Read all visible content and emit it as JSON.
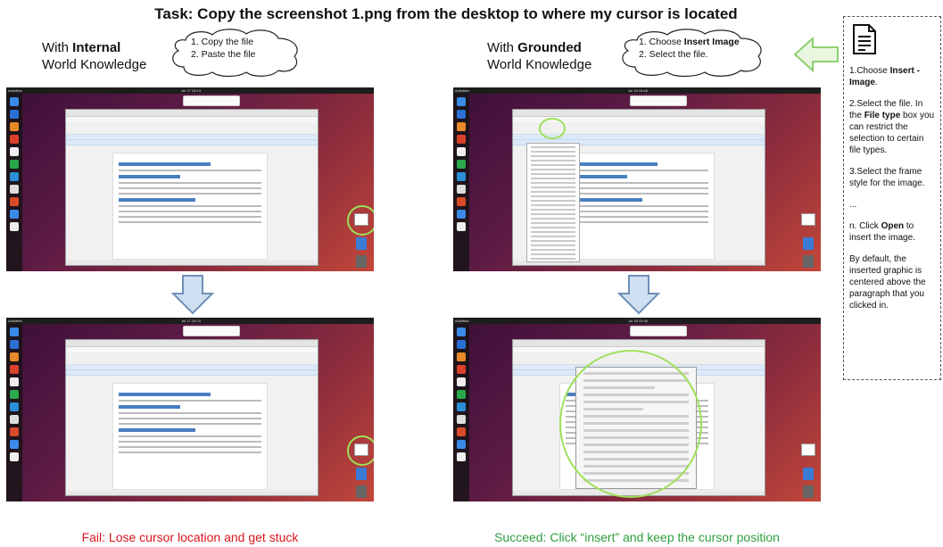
{
  "title": "Task: Copy the screenshot 1.png from the desktop to where my cursor is located",
  "left": {
    "header_prefix": "With ",
    "header_bold": "Internal",
    "header_line2": "World Knowledge",
    "steps": [
      "1. Copy the file",
      "2. Paste the file"
    ],
    "caption": "Fail: Lose cursor location and  get stuck",
    "caption_color": "#d9141b"
  },
  "right": {
    "header_prefix": "With ",
    "header_bold": "Grounded",
    "header_line2": "World Knowledge",
    "step1_prefix": "1. Choose ",
    "step1_bold": "Insert Image",
    "step2": "2. Select the file.",
    "caption": "Succeed: Click “insert” and keep the cursor position",
    "caption_color": "#2e9e3e"
  },
  "knowledge": {
    "icon": "document-icon",
    "s1_prefix": "1.Choose ",
    "s1_bold": "Insert - Image",
    "s1_suffix": ".",
    "s2_prefix": "2.Select the file. In the ",
    "s2_bold": "File type",
    "s2_suffix": " box you can restrict the selection to certain file types.",
    "s3": "3.Select the frame style for the image.",
    "ellipsis": "...",
    "sn_prefix": "n. Click ",
    "sn_bold": "Open",
    "sn_suffix": " to insert the image.",
    "note": "By default, the inserted graphic is centered above the paragraph that you clicked in."
  },
  "screens": {
    "doc_title": "Viewing Your Class Schedule and Textbooks",
    "window_title": "Viewing_Your_Class_Schedule_and_Textbooks.docx - LibreOffice Writer",
    "notification": "Software Updater"
  },
  "colors": {
    "arrow_blue_fill": "#cfe0f3",
    "arrow_blue_stroke": "#6f8fb7",
    "arrow_green_fill": "#e9f7e1",
    "arrow_green_stroke": "#8fcf6f",
    "highlight_green": "#9ee05a"
  }
}
